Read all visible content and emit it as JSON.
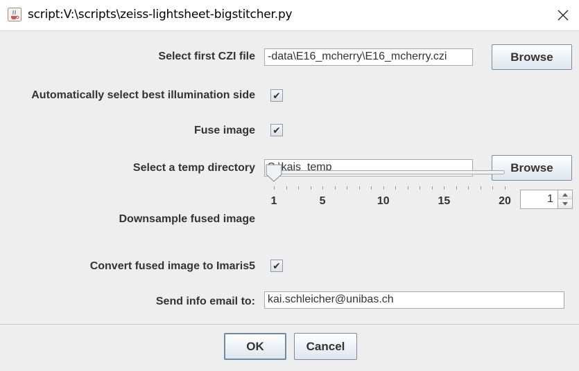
{
  "window": {
    "title": "script:V:\\scripts\\zeiss-lightsheet-bigstitcher.py"
  },
  "form": {
    "czi_label": "Select first CZI file",
    "czi_value": "-data\\E16_mcherry\\E16_mcherry.czi",
    "czi_browse": "Browse",
    "auto_illum_label": "Automatically select best illumination side",
    "auto_illum_checked": true,
    "fuse_label": "Fuse image",
    "fuse_checked": true,
    "temp_label": "Select a temp directory",
    "temp_value": "S:\\kais_temp",
    "temp_browse": "Browse",
    "downsample_label": "Downsample fused image",
    "downsample_min": 1,
    "downsample_max": 20,
    "downsample_value": "1",
    "downsample_tick_labels": [
      "1",
      "5",
      "10",
      "15",
      "20"
    ],
    "imaris_label": "Convert fused image to Imaris5",
    "imaris_checked": true,
    "email_label": "Send info email to:",
    "email_value": "kai.schleicher@unibas.ch"
  },
  "buttons": {
    "ok": "OK",
    "cancel": "Cancel"
  },
  "icons": {
    "app": "java-coffee-cup-icon",
    "close": "close-icon",
    "check": "check-icon"
  }
}
